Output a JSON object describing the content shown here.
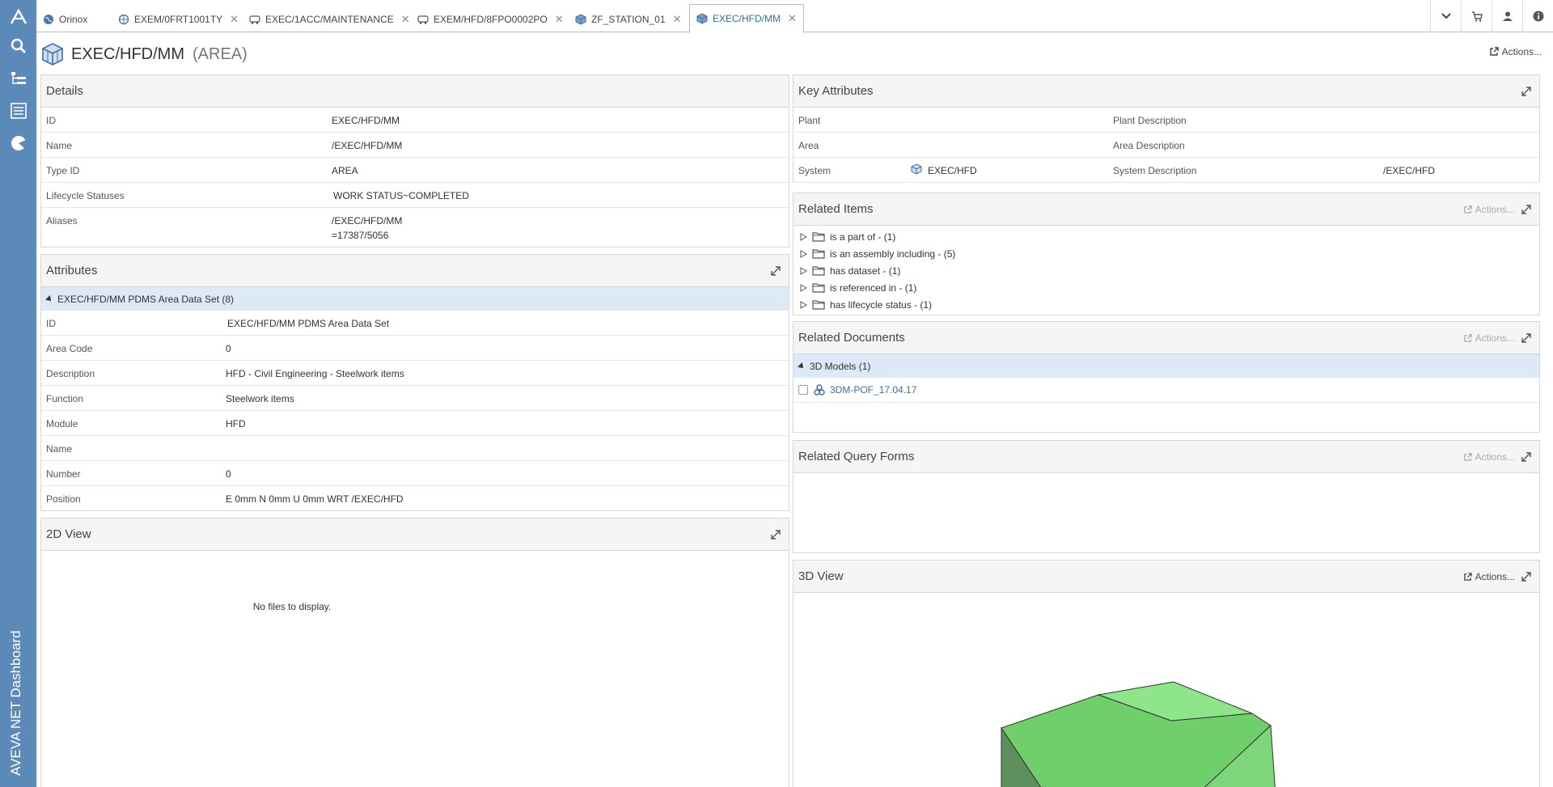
{
  "sidebar": {
    "app_name": "AVEVA NET Dashboard"
  },
  "tabs": [
    {
      "label": "Orinox",
      "icon": "globe-icon"
    },
    {
      "label": "EXEM/0FRT1001TY",
      "icon": "network-icon"
    },
    {
      "label": "EXEC/1ACC/MAINTENANCE",
      "icon": "vehicle-icon"
    },
    {
      "label": "EXEM/HFD/8FPO0002PO",
      "icon": "vehicle-icon"
    },
    {
      "label": "ZF_STATION_01",
      "icon": "cube-icon"
    },
    {
      "label": "EXEC/HFD/MM",
      "icon": "cube-icon",
      "active": true
    }
  ],
  "header": {
    "title": "EXEC/HFD/MM",
    "type": "(AREA)",
    "actions_label": "Actions..."
  },
  "details": {
    "title": "Details",
    "rows": [
      {
        "label": "ID",
        "value": "EXEC/HFD/MM"
      },
      {
        "label": "Name",
        "value": "/EXEC/HFD/MM"
      },
      {
        "label": "Type ID",
        "value": "AREA"
      },
      {
        "label": "Lifecycle Statuses",
        "value": "WORK STATUS~COMPLETED"
      },
      {
        "label": "Aliases",
        "value": "/EXEC/HFD/MM",
        "value2": "=17387/5056"
      }
    ]
  },
  "attributes": {
    "title": "Attributes",
    "group": "EXEC/HFD/MM PDMS Area Data Set (8)",
    "rows": [
      {
        "label": "ID",
        "value": "EXEC/HFD/MM PDMS Area Data Set"
      },
      {
        "label": "Area Code",
        "value": "0"
      },
      {
        "label": "Description",
        "value": "HFD - Civil Engineering - Steelwork items"
      },
      {
        "label": "Function",
        "value": "Steelwork items"
      },
      {
        "label": "Module",
        "value": "HFD"
      },
      {
        "label": "Name",
        "value": ""
      },
      {
        "label": "Number",
        "value": "0"
      },
      {
        "label": "Position",
        "value": "E 0mm N 0mm U 0mm WRT /EXEC/HFD"
      }
    ]
  },
  "view2d": {
    "title": "2D View",
    "empty": "No files to display."
  },
  "key_attributes": {
    "title": "Key Attributes",
    "rows": [
      {
        "label": "Plant",
        "value": "",
        "label2": "Plant Description",
        "value2": ""
      },
      {
        "label": "Area",
        "value": "",
        "label2": "Area Description",
        "value2": ""
      },
      {
        "label": "System",
        "value": "EXEC/HFD",
        "label2": "System Description",
        "value2": "/EXEC/HFD"
      }
    ]
  },
  "related_items": {
    "title": "Related Items",
    "actions_label": "Actions...",
    "items": [
      "is a part of - (1)",
      "is an assembly including - (5)",
      "has dataset - (1)",
      "is referenced in - (1)",
      "has lifecycle status - (1)"
    ]
  },
  "related_documents": {
    "title": "Related Documents",
    "actions_label": "Actions...",
    "group": "3D Models (1)",
    "doc": "3DM-POF_17.04.17"
  },
  "related_query_forms": {
    "title": "Related Query Forms",
    "actions_label": "Actions..."
  },
  "view3d": {
    "title": "3D View",
    "actions_label": "Actions...",
    "model_color": "#7ed67a"
  },
  "colors": {
    "sidebar": "#5b8ab8",
    "link": "#3d6fa3",
    "group_bar": "#dde9f7"
  }
}
